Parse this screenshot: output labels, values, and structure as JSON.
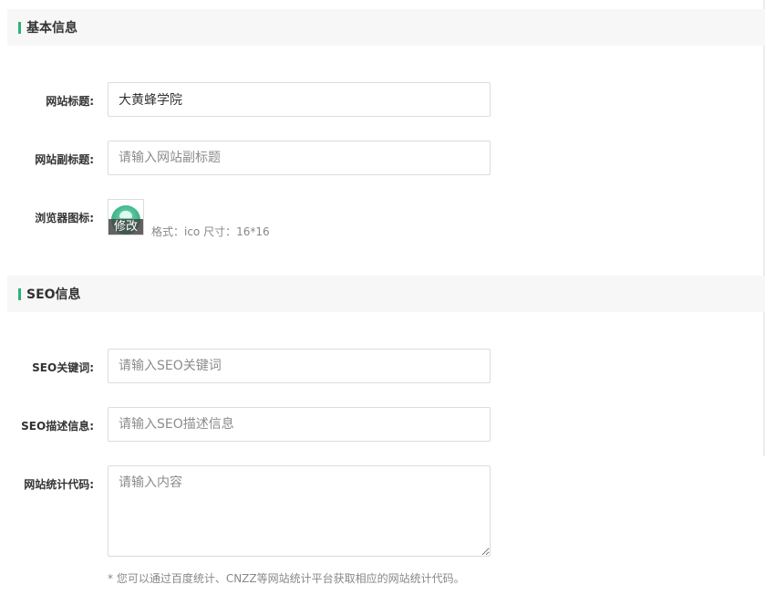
{
  "basic_section": {
    "title": "基本信息",
    "site_title": {
      "label": "网站标题:",
      "value": "大黄蜂学院"
    },
    "site_subtitle": {
      "label": "网站副标题:",
      "placeholder": "请输入网站副标题",
      "value": ""
    },
    "favicon": {
      "label": "浏览器图标:",
      "edit_label": "修改",
      "hint": "格式：ico 尺寸：16*16"
    }
  },
  "seo_section": {
    "title": "SEO信息",
    "keywords": {
      "label": "SEO关键词:",
      "placeholder": "请输入SEO关键词",
      "value": ""
    },
    "description": {
      "label": "SEO描述信息:",
      "placeholder": "请输入SEO描述信息",
      "value": ""
    },
    "analytics": {
      "label": "网站统计代码:",
      "placeholder": "请输入内容",
      "value": "",
      "hint": "* 您可以通过百度统计、CNZZ等网站统计平台获取相应的网站统计代码。"
    }
  },
  "colors": {
    "accent": "#2bb37a",
    "header_bg": "#f7f7f7",
    "border": "#dcdcdc"
  }
}
